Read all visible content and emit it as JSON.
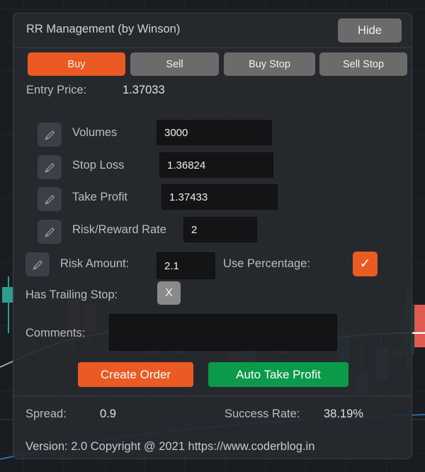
{
  "panel": {
    "title": "RR Management (by Winson)",
    "hide_label": "Hide"
  },
  "order_types": [
    {
      "label": "Buy",
      "name": "buy",
      "active": true
    },
    {
      "label": "Sell",
      "name": "sell",
      "active": false
    },
    {
      "label": "Buy Stop",
      "name": "buy-stop",
      "active": false
    },
    {
      "label": "Sell Stop",
      "name": "sell-stop",
      "active": false
    }
  ],
  "entry_price": {
    "label": "Entry Price:",
    "value": "1.37033"
  },
  "fields": {
    "volumes": {
      "label": "Volumes",
      "value": "3000",
      "icon": "pencil-icon"
    },
    "stop_loss": {
      "label": "Stop Loss",
      "value": "1.36824",
      "icon": "pencil-icon"
    },
    "take_profit": {
      "label": "Take Profit",
      "value": "1.37433",
      "icon": "pencil-icon"
    },
    "risk_reward": {
      "label": "Risk/Reward Rate",
      "value": "2",
      "icon": "pencil-icon"
    },
    "risk_amount": {
      "label": "Risk Amount:",
      "value": "2.1",
      "icon": "pencil-icon"
    }
  },
  "use_percentage": {
    "label": "Use Percentage:",
    "checked_glyph": "✓",
    "checked": true
  },
  "trailing_stop": {
    "label": "Has Trailing Stop:",
    "toggle_glyph": "X",
    "enabled": false
  },
  "comments": {
    "label": "Comments:",
    "value": "",
    "placeholder": ""
  },
  "actions": {
    "create_order": "Create Order",
    "auto_take_profit": "Auto Take Profit"
  },
  "footer": {
    "spread_label": "Spread:",
    "spread_value": "0.9",
    "success_rate_label": "Success Rate:",
    "success_rate_value": "38.19%",
    "version_line": "Version: 2.0  Copyright @ 2021 https://www.coderblog.in"
  },
  "colors": {
    "accent_orange": "#ea5a22",
    "accent_green": "#0a9a4a",
    "neutral_button": "#6b6b6b",
    "panel_background": "#272a2f",
    "input_background": "#141416",
    "text_primary": "#dfe1e4",
    "text_muted": "#b9bcc0"
  }
}
